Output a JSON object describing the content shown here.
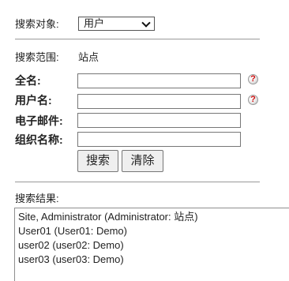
{
  "search_object": {
    "label": "搜索对象:",
    "selected": "用户"
  },
  "search_scope": {
    "label": "搜索范围:",
    "value": "站点"
  },
  "form": {
    "full_name_label": "全名:",
    "username_label": "用户名:",
    "email_label": "电子邮件:",
    "org_name_label": "组织名称:",
    "full_name_value": "",
    "username_value": "",
    "email_value": "",
    "org_name_value": "",
    "help_glyph": "?"
  },
  "buttons": {
    "search": "搜索",
    "clear": "清除"
  },
  "results": {
    "label": "搜索结果:",
    "rows": [
      "Site, Administrator (Administrator: 站点)",
      "User01 (User01: Demo)",
      "user02 (user02: Demo)",
      "user03 (user03: Demo)"
    ]
  },
  "colors": {
    "help_mark": "#d01010",
    "divider": "#999999"
  },
  "icons": [
    "chevron-down-icon",
    "help-icon"
  ]
}
